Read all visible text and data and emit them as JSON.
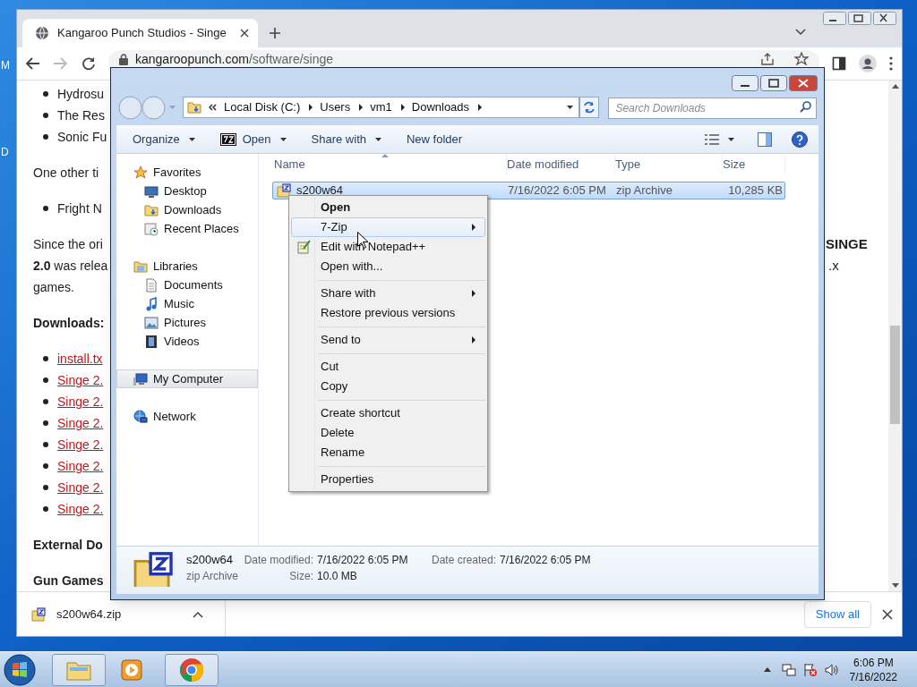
{
  "desktop": {
    "icon_labels": [
      "M",
      "D"
    ]
  },
  "browser": {
    "tab_title": "Kangaroo Punch Studios - Singe",
    "address": {
      "domain": "kangaroopunch.com",
      "path": "/software/singe"
    },
    "page_left": [
      {
        "kind": "bullet",
        "text": "Hydrosu"
      },
      {
        "kind": "bullet",
        "text": "The Res"
      },
      {
        "kind": "bullet",
        "text": "Sonic Fu"
      },
      {
        "kind": "para",
        "lines": [
          "One other ti"
        ]
      },
      {
        "kind": "bullet",
        "text": "Fright N"
      },
      {
        "kind": "para",
        "lines": [
          "Since the ori",
          "**2.0** was relea",
          "games."
        ]
      },
      {
        "kind": "heading",
        "text": "Downloads:"
      },
      {
        "kind": "link",
        "text": "install.tx"
      },
      {
        "kind": "link",
        "text": "Singe 2."
      },
      {
        "kind": "link",
        "text": "Singe 2."
      },
      {
        "kind": "link",
        "text": "Singe 2."
      },
      {
        "kind": "link",
        "text": "Singe 2."
      },
      {
        "kind": "link",
        "text": "Singe 2."
      },
      {
        "kind": "link",
        "text": "Singe 2."
      },
      {
        "kind": "link",
        "text": "Singe 2."
      },
      {
        "kind": "heading",
        "text": "External Do"
      },
      {
        "kind": "heading",
        "text": "Gun Games"
      }
    ],
    "page_right": [
      {
        "kind": "heading",
        "text": "SINGE"
      },
      {
        "kind": "para",
        "text": ".x"
      }
    ],
    "download": {
      "file": "s200w64.zip",
      "button": "Show all"
    }
  },
  "explorer": {
    "breadcrumb": [
      "Local Disk (C:)",
      "Users",
      "vm1",
      "Downloads"
    ],
    "search": {
      "placeholder": "Search Downloads"
    },
    "toolbar": [
      {
        "kind": "menu",
        "label": "Organize"
      },
      {
        "kind": "zip_menu",
        "label": "Open"
      },
      {
        "kind": "menu",
        "label": "Share with"
      },
      {
        "kind": "plain",
        "label": "New folder"
      }
    ],
    "nav_pane": [
      {
        "kind": "favorites",
        "label": "Favorites",
        "selected": false,
        "children": [
          {
            "kind": "desktop",
            "label": "Desktop",
            "selected": false
          },
          {
            "kind": "downloads",
            "label": "Downloads",
            "selected": false
          },
          {
            "kind": "recent",
            "label": "Recent Places",
            "selected": false
          }
        ]
      },
      {
        "kind": "libraries",
        "label": "Libraries",
        "selected": false,
        "children": [
          {
            "kind": "documents",
            "label": "Documents",
            "selected": false
          },
          {
            "kind": "music",
            "label": "Music",
            "selected": false
          },
          {
            "kind": "pictures",
            "label": "Pictures",
            "selected": false
          },
          {
            "kind": "videos",
            "label": "Videos",
            "selected": false
          }
        ]
      },
      {
        "kind": "computer",
        "label": "My Computer",
        "selected": true
      },
      {
        "kind": "network",
        "label": "Network",
        "selected": false
      }
    ],
    "columns": [
      "Name",
      "Date modified",
      "Type",
      "Size"
    ],
    "files": [
      {
        "name": "s200w64",
        "date_modified": "7/16/2022 6:05 PM",
        "type": "zip Archive",
        "size": "10,285 KB",
        "selected": true
      }
    ],
    "context_menu": [
      {
        "kind": "item",
        "label": "Open",
        "default": true,
        "selected": false,
        "submenu": false
      },
      {
        "kind": "item",
        "label": "7-Zip",
        "default": false,
        "selected": true,
        "submenu": true
      },
      {
        "kind": "icon_item",
        "label": "Edit with Notepad++",
        "default": false,
        "selected": false,
        "submenu": false
      },
      {
        "kind": "item",
        "label": "Open with...",
        "default": false,
        "selected": false,
        "submenu": false
      },
      {
        "kind": "separator"
      },
      {
        "kind": "item",
        "label": "Share with",
        "default": false,
        "selected": false,
        "submenu": true
      },
      {
        "kind": "item",
        "label": "Restore previous versions",
        "default": false,
        "selected": false,
        "submenu": false
      },
      {
        "kind": "separator"
      },
      {
        "kind": "item",
        "label": "Send to",
        "default": false,
        "selected": false,
        "submenu": true
      },
      {
        "kind": "separator"
      },
      {
        "kind": "item",
        "label": "Cut",
        "default": false,
        "selected": false,
        "submenu": false
      },
      {
        "kind": "item",
        "label": "Copy",
        "default": false,
        "selected": false,
        "submenu": false
      },
      {
        "kind": "separator"
      },
      {
        "kind": "item",
        "label": "Create shortcut",
        "default": false,
        "selected": false,
        "submenu": false
      },
      {
        "kind": "item",
        "label": "Delete",
        "default": false,
        "selected": false,
        "submenu": false
      },
      {
        "kind": "item",
        "label": "Rename",
        "default": false,
        "selected": false,
        "submenu": false
      },
      {
        "kind": "separator"
      },
      {
        "kind": "item",
        "label": "Properties",
        "default": false,
        "selected": false,
        "submenu": false
      }
    ],
    "details": {
      "name": "s200w64",
      "type": "zip Archive",
      "columns": [
        [
          {
            "label": "Date modified:",
            "value": "7/16/2022 6:05 PM"
          },
          {
            "label": "Size:",
            "value": "10.0 MB"
          }
        ],
        [
          {
            "label": "Date created:",
            "value": "7/16/2022 6:05 PM"
          }
        ]
      ]
    }
  },
  "taskbar": {
    "apps": [
      {
        "kind": "explorer",
        "running": true
      },
      {
        "kind": "media_player",
        "running": false
      },
      {
        "kind": "chrome",
        "running": true
      }
    ],
    "time": "6:06 PM",
    "date": "7/16/2022"
  }
}
